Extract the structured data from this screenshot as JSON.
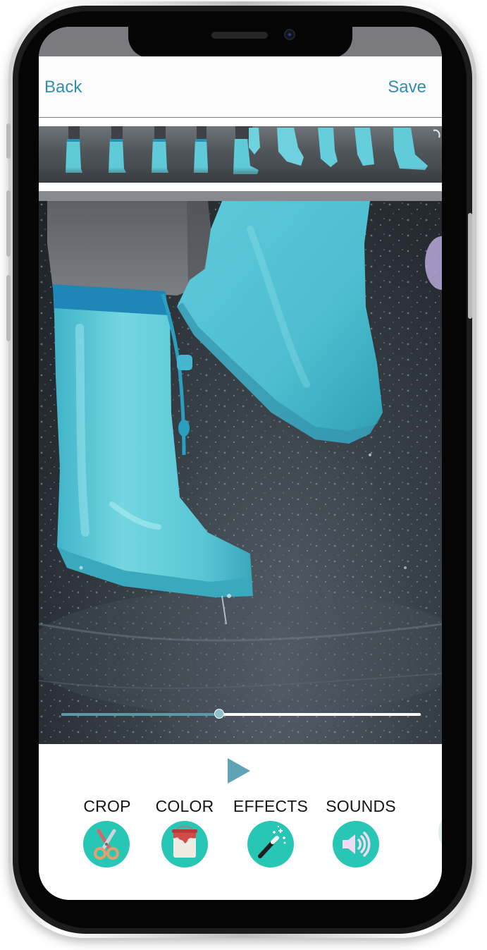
{
  "nav": {
    "back_label": "Back",
    "save_label": "Save"
  },
  "video": {
    "progress": 0.44
  },
  "tools": [
    {
      "label": "CROP",
      "icon": "scissors-icon"
    },
    {
      "label": "COLOR",
      "icon": "paint-bucket-icon"
    },
    {
      "label": "EFFECTS",
      "icon": "magic-wand-icon"
    },
    {
      "label": "SOUNDS",
      "icon": "speaker-icon"
    }
  ],
  "colors": {
    "accent": "#2f8fb0",
    "tool_circle": "#28c6b5",
    "boot": "#5fcad8",
    "play": "#5ea4b4"
  }
}
